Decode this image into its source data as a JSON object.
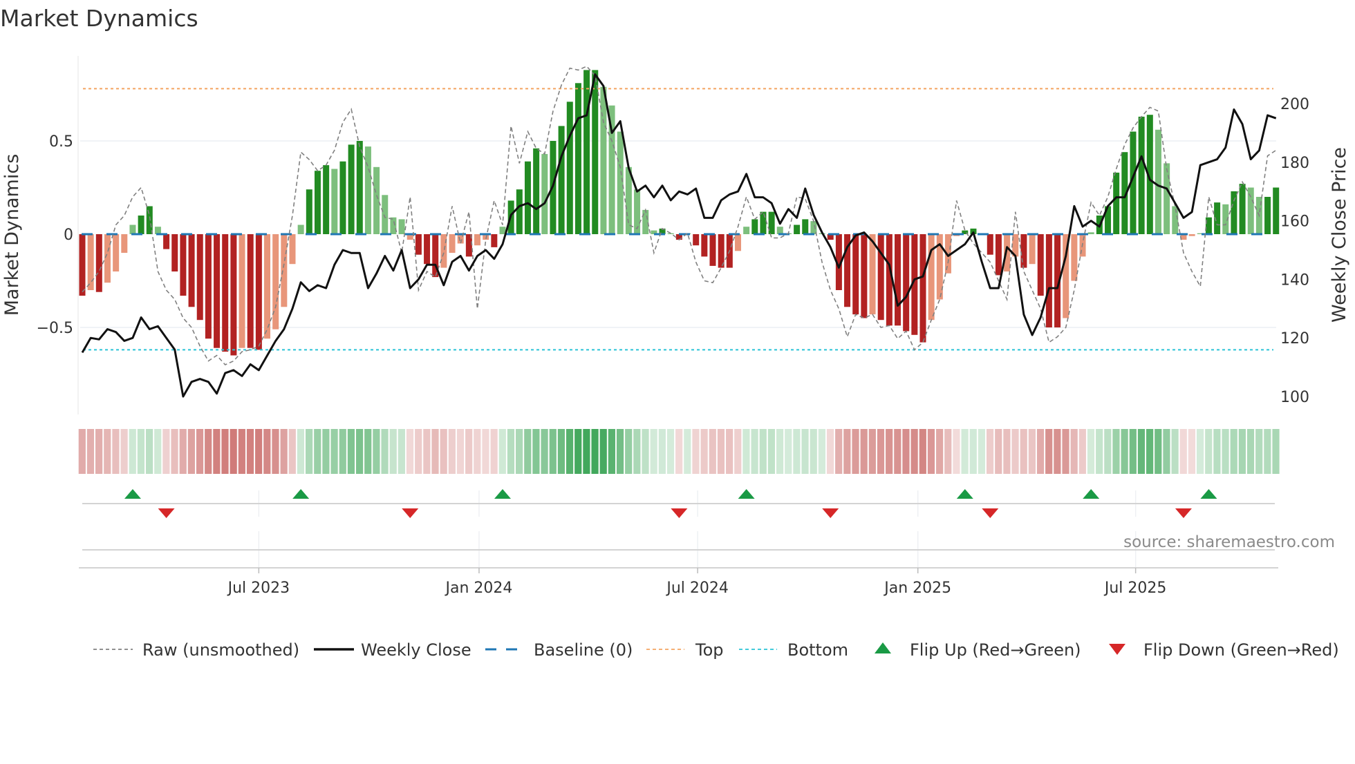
{
  "chart_data": {
    "type": "bar",
    "title": "Market Dynamics",
    "ylabel": "Market Dynamics",
    "y2label": "Weekly Close Price",
    "ylim": [
      -0.96,
      0.96
    ],
    "y2lim": [
      97,
      214
    ],
    "yticks": [
      {
        "v": 0.5,
        "label": "0.5"
      },
      {
        "v": 0,
        "label": "0"
      },
      {
        "v": -0.5,
        "label": "−0.5"
      }
    ],
    "y2ticks": [
      {
        "v": 200,
        "label": "200"
      },
      {
        "v": 180,
        "label": "180"
      },
      {
        "v": 160,
        "label": "160"
      },
      {
        "v": 140,
        "label": "140"
      },
      {
        "v": 120,
        "label": "120"
      },
      {
        "v": 100,
        "label": "100"
      }
    ],
    "xticks": [
      {
        "week": 21,
        "label": "Jul 2023"
      },
      {
        "week": 47.2,
        "label": "Jan 2024"
      },
      {
        "week": 73.2,
        "label": "Jul 2024"
      },
      {
        "week": 99.4,
        "label": "Jan 2025"
      },
      {
        "week": 125.3,
        "label": "Jul 2025"
      }
    ],
    "grid": true,
    "top_level": 0.78,
    "bottom_level": -0.62,
    "baseline": 0,
    "momentum": [
      -0.33,
      -0.3,
      -0.31,
      -0.26,
      -0.2,
      -0.1,
      0.05,
      0.1,
      0.15,
      0.04,
      -0.08,
      -0.2,
      -0.33,
      -0.39,
      -0.46,
      -0.56,
      -0.61,
      -0.63,
      -0.65,
      -0.61,
      -0.61,
      -0.62,
      -0.56,
      -0.51,
      -0.39,
      -0.16,
      0.05,
      0.24,
      0.34,
      0.37,
      0.35,
      0.39,
      0.48,
      0.5,
      0.47,
      0.36,
      0.21,
      0.09,
      0.08,
      -0.03,
      -0.11,
      -0.16,
      -0.23,
      -0.18,
      -0.1,
      -0.05,
      -0.12,
      -0.06,
      -0.03,
      -0.07,
      0.04,
      0.18,
      0.24,
      0.39,
      0.46,
      0.43,
      0.5,
      0.58,
      0.71,
      0.81,
      0.88,
      0.88,
      0.79,
      0.69,
      0.55,
      0.36,
      0.24,
      0.13,
      0.02,
      0.03,
      0.005,
      -0.03,
      0.005,
      -0.06,
      -0.12,
      -0.17,
      -0.18,
      -0.18,
      -0.09,
      0.04,
      0.08,
      0.12,
      0.12,
      0.04,
      0.005,
      0.05,
      0.08,
      0.07,
      0.005,
      -0.03,
      -0.3,
      -0.39,
      -0.43,
      -0.45,
      -0.43,
      -0.46,
      -0.49,
      -0.49,
      -0.52,
      -0.54,
      -0.58,
      -0.46,
      -0.35,
      -0.21,
      -0.01,
      0.02,
      0.03,
      0.005,
      -0.11,
      -0.22,
      -0.2,
      -0.12,
      -0.18,
      -0.16,
      -0.33,
      -0.5,
      -0.5,
      -0.45,
      -0.25,
      -0.12,
      0.01,
      0.1,
      0.15,
      0.33,
      0.44,
      0.55,
      0.63,
      0.64,
      0.56,
      0.38,
      0.15,
      -0.03,
      -0.01,
      0.005,
      0.09,
      0.17,
      0.16,
      0.23,
      0.27,
      0.25,
      0.2,
      0.2,
      0.25
    ],
    "raw": [
      -0.31,
      -0.26,
      -0.2,
      -0.1,
      0.05,
      0.1,
      0.2,
      0.25,
      0.1,
      -0.2,
      -0.3,
      -0.35,
      -0.45,
      -0.5,
      -0.6,
      -0.68,
      -0.65,
      -0.7,
      -0.68,
      -0.63,
      -0.62,
      -0.6,
      -0.51,
      -0.39,
      -0.16,
      0.1,
      0.44,
      0.4,
      0.34,
      0.37,
      0.45,
      0.6,
      0.67,
      0.47,
      0.36,
      0.21,
      0.09,
      0.08,
      -0.1,
      0.2,
      -0.3,
      -0.2,
      -0.23,
      -0.1,
      0.15,
      -0.05,
      0.12,
      -0.4,
      -0.03,
      0.18,
      0.05,
      0.58,
      0.38,
      0.55,
      0.46,
      0.43,
      0.66,
      0.8,
      0.89,
      0.88,
      0.9,
      0.85,
      0.6,
      0.5,
      0.36,
      0.05,
      0.03,
      0.13,
      -0.1,
      0.03,
      0.005,
      -0.03,
      0.005,
      -0.15,
      -0.25,
      -0.26,
      -0.18,
      -0.09,
      0.04,
      0.2,
      0.08,
      0.12,
      -0.02,
      -0.02,
      0.005,
      0.2,
      0.19,
      0.07,
      -0.15,
      -0.3,
      -0.4,
      -0.55,
      -0.43,
      -0.45,
      -0.43,
      -0.5,
      -0.49,
      -0.56,
      -0.52,
      -0.62,
      -0.58,
      -0.46,
      -0.35,
      -0.15,
      0.18,
      0.02,
      -0.05,
      -0.1,
      -0.15,
      -0.25,
      -0.35,
      0.12,
      -0.2,
      -0.3,
      -0.4,
      -0.58,
      -0.55,
      -0.5,
      -0.3,
      -0.05,
      0.17,
      0.1,
      0.2,
      0.35,
      0.48,
      0.57,
      0.63,
      0.68,
      0.66,
      0.35,
      0.15,
      -0.1,
      -0.2,
      -0.28,
      0.2,
      0.05,
      0.05,
      0.18,
      0.28,
      0.2,
      0.1,
      0.42,
      0.45
    ],
    "weekly_close": [
      115,
      120,
      119.5,
      123,
      122,
      119,
      120,
      127,
      123,
      124,
      120,
      116,
      100,
      105,
      106,
      105,
      101,
      108,
      109,
      107,
      111,
      109,
      114,
      119,
      123,
      130,
      139,
      136,
      138,
      137,
      145,
      150,
      149,
      149,
      137,
      142,
      148,
      143,
      150,
      137,
      140,
      145,
      145,
      138,
      146,
      148,
      143,
      148,
      150,
      147,
      152,
      162,
      165,
      166,
      164,
      166,
      172,
      182,
      189,
      195,
      196,
      210,
      206,
      190,
      194,
      178,
      170,
      172,
      168,
      172,
      167,
      170,
      169,
      171,
      161,
      161,
      167,
      169,
      170,
      176,
      168,
      168,
      166,
      159,
      164,
      161,
      171,
      162,
      156,
      151,
      144,
      151,
      155,
      156,
      153,
      149,
      145,
      131,
      134,
      140,
      141,
      150,
      152,
      148,
      150,
      152,
      156,
      146,
      137,
      137,
      151,
      148,
      128,
      121,
      127,
      137,
      137,
      148,
      165,
      158,
      160,
      158,
      165,
      168,
      168,
      175,
      182,
      174,
      172,
      171,
      166,
      161,
      163,
      179,
      180,
      181,
      185,
      198,
      193,
      181,
      184,
      196,
      195
    ],
    "flip_up_weeks": [
      6,
      26,
      50,
      79,
      105,
      120,
      134
    ],
    "flip_down_weeks": [
      10,
      39,
      71,
      89,
      108,
      131
    ],
    "legend": {
      "position": "bottom",
      "items": [
        {
          "label": "Raw (unsmoothed)",
          "kind": "dashed-line",
          "color": "#808080"
        },
        {
          "label": "Weekly Close",
          "kind": "line",
          "color": "#111111"
        },
        {
          "label": "Baseline (0)",
          "kind": "dash-line",
          "color": "#1f77b4"
        },
        {
          "label": "Top",
          "kind": "dotted-line",
          "color": "#f4a460"
        },
        {
          "label": "Bottom",
          "kind": "dotted-line",
          "color": "#29c4d6"
        },
        {
          "label": "Flip Up (Red→Green)",
          "kind": "triangle-up",
          "color": "#1a9a45"
        },
        {
          "label": "Flip Down (Green→Red)",
          "kind": "triangle-down",
          "color": "#d62728"
        }
      ]
    },
    "source": "source: sharemaestro.com",
    "colors": {
      "green_strong": "#228b22",
      "green_weak": "#7dbf7d",
      "red_strong": "#b22222",
      "red_weak": "#e8967a",
      "heat_green": "#2e9e4a",
      "heat_red": "#c0504d"
    }
  }
}
